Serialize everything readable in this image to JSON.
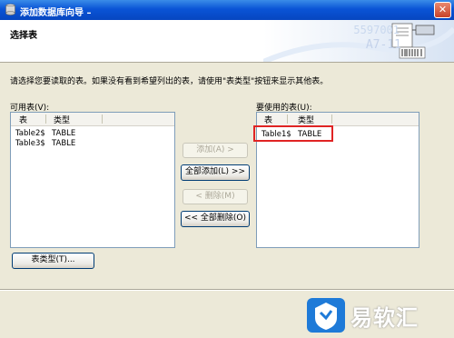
{
  "window": {
    "title": "添加数据库向导",
    "title_suffix": "–",
    "close_label": "✕"
  },
  "header": {
    "step_title": "选择表",
    "banner_line1": "5597001",
    "banner_line2": "A7-11"
  },
  "instruction": "请选择您要读取的表。如果没有看到希望列出的表，请使用\"表类型\"按钮来显示其他表。",
  "available": {
    "label": "可用表(V):",
    "columns": [
      "表",
      "类型"
    ],
    "rows": [
      {
        "name": "Table2$",
        "type": "TABLE"
      },
      {
        "name": "Table3$",
        "type": "TABLE"
      }
    ]
  },
  "selected": {
    "label": "要使用的表(U):",
    "columns": [
      "表",
      "类型"
    ],
    "rows": [
      {
        "name": "Table1$",
        "type": "TABLE"
      }
    ]
  },
  "buttons": {
    "add": "添加(A) >",
    "add_all": "全部添加(L) >>",
    "remove": "< 删除(M)",
    "remove_all": "<< 全部删除(O)",
    "table_types": "表类型(T)..."
  },
  "watermark": {
    "text": "易软汇"
  },
  "colors": {
    "title_bar": "#0a54d6",
    "highlight": "#e02424",
    "watermark_bg": "#1e7ad8"
  }
}
